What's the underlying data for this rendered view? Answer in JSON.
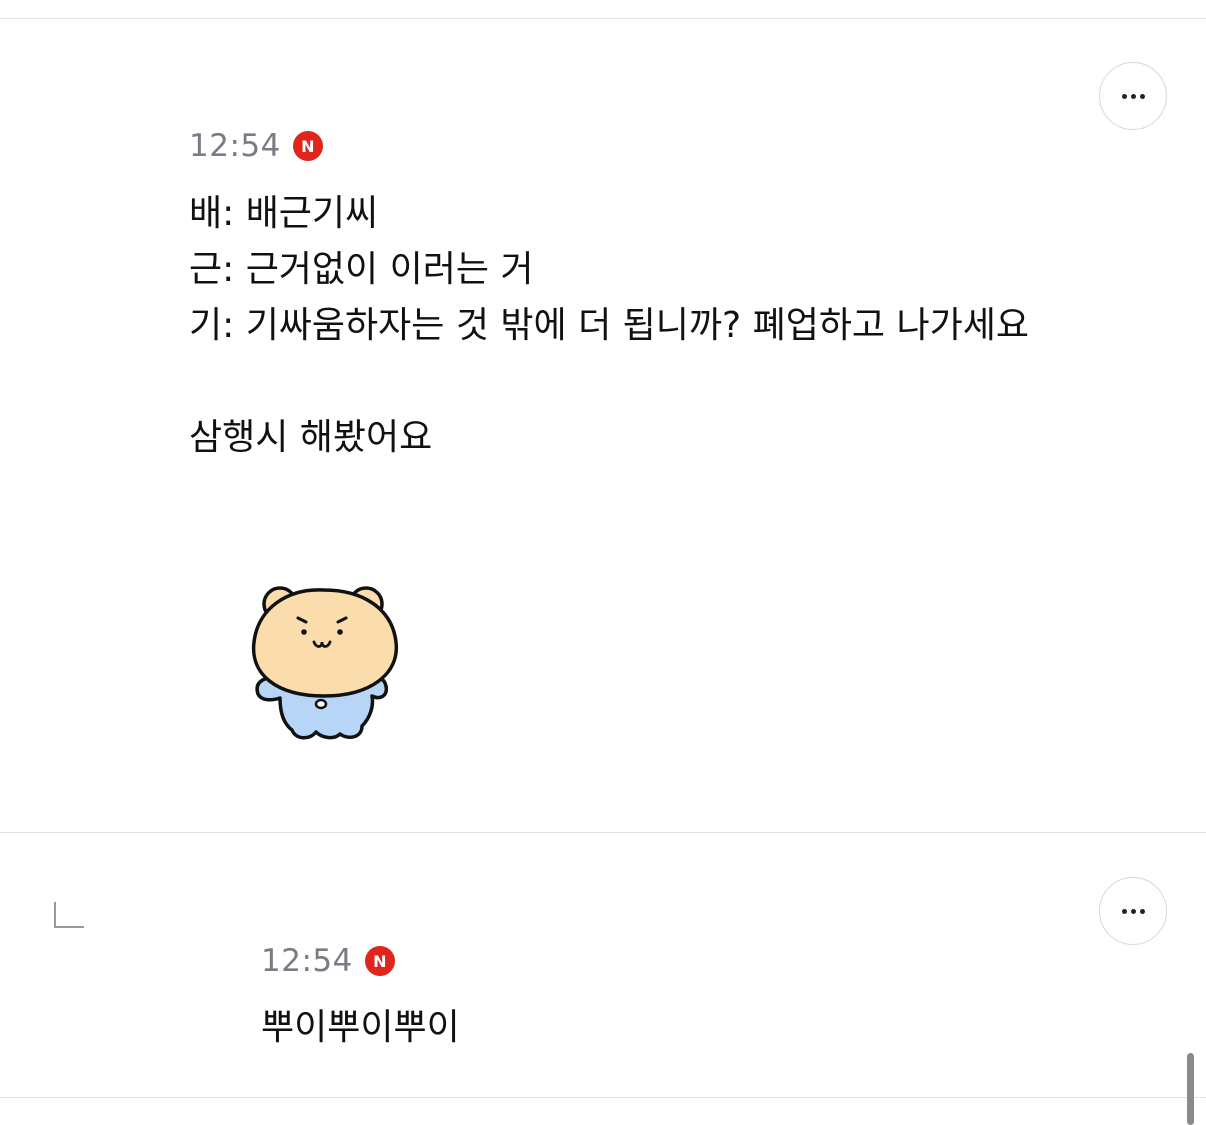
{
  "comments": [
    {
      "time": "12:54",
      "badge": "N",
      "lines": [
        "배: 배근기씨",
        "근: 근거없이 이러는 거",
        "기: 기싸움하자는 것 밖에 더 됩니까? 폐업하고 나가세요",
        "",
        "삼행시 해봤어요"
      ],
      "sticker": "bear-sticker-icon",
      "more_icon": "more-options-icon"
    },
    {
      "time": "12:54",
      "badge": "N",
      "lines": [
        "뿌이뿌이뿌이"
      ],
      "reply_icon": "reply-arrow-icon",
      "more_icon": "more-options-icon"
    }
  ],
  "colors": {
    "badge": "#e0261c",
    "time": "#7b7b85",
    "bear_face": "#fbdcac",
    "bear_body": "#b7d6f7"
  }
}
